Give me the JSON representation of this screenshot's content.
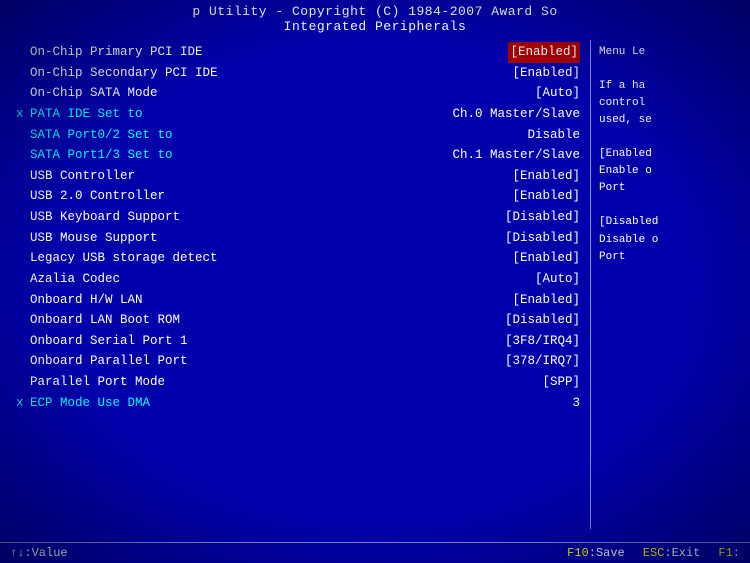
{
  "header": {
    "line1": "p Utility - Copyright (C) 1984-2007 Award So",
    "line2": "Integrated Peripherals"
  },
  "rows": [
    {
      "marker": " ",
      "label": "On-Chip Primary    PCI IDE",
      "value": "[Enabled]",
      "highlight": true,
      "cyan": false
    },
    {
      "marker": " ",
      "label": "On-Chip Secondary  PCI IDE",
      "value": "[Enabled]",
      "highlight": false,
      "cyan": false
    },
    {
      "marker": " ",
      "label": "On-Chip SATA Mode",
      "value": "[Auto]",
      "highlight": false,
      "cyan": false
    },
    {
      "marker": "x",
      "label": "PATA IDE Set to",
      "value": "Ch.0 Master/Slave",
      "highlight": false,
      "cyan": true
    },
    {
      "marker": " ",
      "label": "SATA Port0/2 Set to",
      "value": "Disable",
      "highlight": false,
      "cyan": true
    },
    {
      "marker": " ",
      "label": "SATA Port1/3 Set to",
      "value": "Ch.1 Master/Slave",
      "highlight": false,
      "cyan": true
    },
    {
      "marker": " ",
      "label": "USB Controller",
      "value": "[Enabled]",
      "highlight": false,
      "cyan": false
    },
    {
      "marker": " ",
      "label": "USB 2.0 Controller",
      "value": "[Enabled]",
      "highlight": false,
      "cyan": false
    },
    {
      "marker": " ",
      "label": "USB Keyboard Support",
      "value": "[Disabled]",
      "highlight": false,
      "cyan": false
    },
    {
      "marker": " ",
      "label": "USB Mouse Support",
      "value": "[Disabled]",
      "highlight": false,
      "cyan": false
    },
    {
      "marker": " ",
      "label": "Legacy USB storage detect",
      "value": "[Enabled]",
      "highlight": false,
      "cyan": false
    },
    {
      "marker": " ",
      "label": "Azalia Codec",
      "value": "[Auto]",
      "highlight": false,
      "cyan": false
    },
    {
      "marker": " ",
      "label": "Onboard H/W LAN",
      "value": "[Enabled]",
      "highlight": false,
      "cyan": false
    },
    {
      "marker": " ",
      "label": "Onboard LAN Boot ROM",
      "value": "[Disabled]",
      "highlight": false,
      "cyan": false
    },
    {
      "marker": " ",
      "label": "Onboard Serial Port 1",
      "value": "[3F8/IRQ4]",
      "highlight": false,
      "cyan": false
    },
    {
      "marker": " ",
      "label": "Onboard Parallel Port",
      "value": "[378/IRQ7]",
      "highlight": false,
      "cyan": false
    },
    {
      "marker": " ",
      "label": "Parallel Port Mode",
      "value": "[SPP]",
      "highlight": false,
      "cyan": false
    },
    {
      "marker": "x",
      "label": "ECP Mode Use DMA",
      "value": "3",
      "highlight": false,
      "cyan": true
    }
  ],
  "right_panel": {
    "lines": [
      "Menu Le",
      "",
      "If a ha",
      "control",
      "used, se",
      "",
      "[Enabled",
      "Enable o",
      "Port",
      "",
      "[Disabled",
      "Disable o",
      "Port"
    ]
  },
  "footer": {
    "nav_label": "↑↓:Value",
    "f10_key": "F10",
    "f10_desc": ":Save",
    "esc_key": "ESC",
    "esc_desc": ":Exit",
    "f1_key": "F1",
    "f1_desc": ":"
  }
}
